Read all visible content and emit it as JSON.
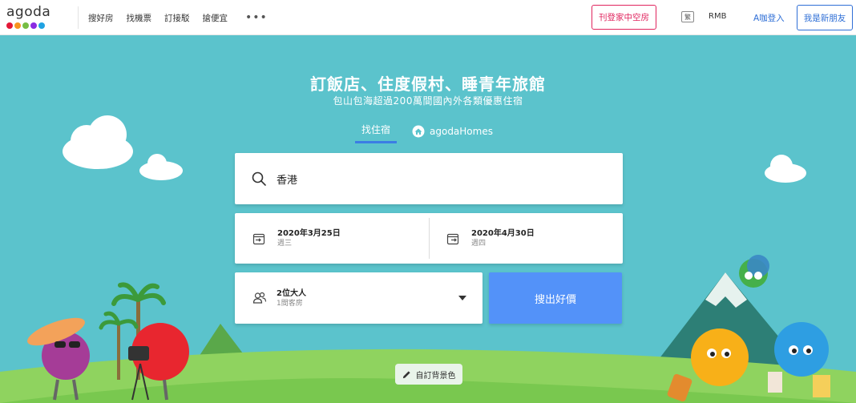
{
  "header": {
    "logo_text": "agoda",
    "logo_colors": [
      "#e31837",
      "#f7941d",
      "#76bd43",
      "#8a2be2",
      "#1fa2e2"
    ],
    "nav": [
      "搜好房",
      "找機票",
      "訂接駁",
      "搶便宜"
    ],
    "more": "•••",
    "list_property": "刊登家中空房",
    "lang_icon": "繁",
    "currency": "RMB",
    "login": "A咖登入",
    "signup": "我是新朋友"
  },
  "hero": {
    "title": "訂飯店、住度假村、睡青年旅館",
    "subtitle": "包山包海超過200萬間國內外各類優惠住宿",
    "tab_hotels": "找住宿",
    "tab_homes": "agodaHomes"
  },
  "search": {
    "destination": "香港",
    "checkin_date": "2020年3月25日",
    "checkin_dow": "週三",
    "checkout_date": "2020年4月30日",
    "checkout_dow": "週四",
    "guests_main": "2位大人",
    "guests_sub": "1間客房",
    "submit": "搜出好價"
  },
  "footer": {
    "customize_bg": "自訂背景色"
  },
  "colors": {
    "sky": "#5bc3cc",
    "accent_blue": "#5392f9",
    "brand_red": "#e0245e"
  }
}
